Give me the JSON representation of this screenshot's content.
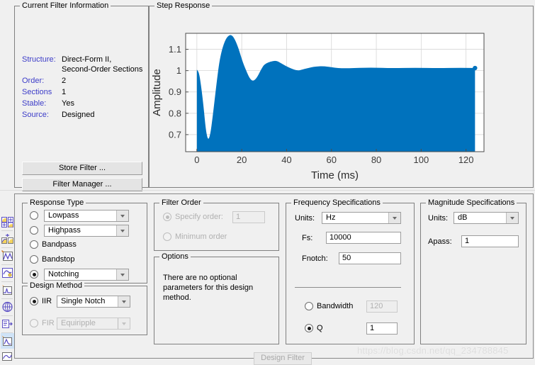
{
  "filter_info": {
    "title": "Current Filter Information",
    "rows": [
      {
        "key": "Structure:",
        "value": "Direct-Form II,",
        "value2": "Second-Order Sections"
      },
      {
        "key": "Order:",
        "value": "2"
      },
      {
        "key": "Sections",
        "value": "1"
      },
      {
        "key": "Stable:",
        "value": "Yes"
      },
      {
        "key": "Source:",
        "value": "Designed"
      }
    ],
    "store_filter_label": "Store Filter ...",
    "filter_manager_label": "Filter Manager ..."
  },
  "step_response": {
    "title": "Step Response"
  },
  "chart_data": {
    "type": "area",
    "title": "Step Response",
    "xlabel": "Time (ms)",
    "ylabel": "Amplitude",
    "xlim": [
      -5,
      128
    ],
    "ylim": [
      0.62,
      1.175
    ],
    "xticks": [
      0,
      20,
      40,
      60,
      80,
      100,
      120
    ],
    "yticks": [
      0.7,
      0.8,
      0.9,
      1,
      1.1
    ],
    "grid": true,
    "legend": "none",
    "series_color": "#0072BD",
    "note": "Dense sinusoidal ringing at notch frequency; plotted envelope of step response. Filled region spans lower clip of axis up to upper envelope.",
    "envelope_upper": [
      {
        "t": 0,
        "v": 1.005
      },
      {
        "t": 1,
        "v": 0.99
      },
      {
        "t": 2,
        "v": 0.92
      },
      {
        "t": 3,
        "v": 0.83
      },
      {
        "t": 4,
        "v": 0.72
      },
      {
        "t": 5,
        "v": 0.672
      },
      {
        "t": 6,
        "v": 0.7
      },
      {
        "t": 7,
        "v": 0.78
      },
      {
        "t": 8,
        "v": 0.87
      },
      {
        "t": 9,
        "v": 0.96
      },
      {
        "t": 10,
        "v": 1.04
      },
      {
        "t": 11,
        "v": 1.09
      },
      {
        "t": 12,
        "v": 1.125
      },
      {
        "t": 13,
        "v": 1.15
      },
      {
        "t": 14,
        "v": 1.163
      },
      {
        "t": 15,
        "v": 1.168
      },
      {
        "t": 16,
        "v": 1.162
      },
      {
        "t": 17,
        "v": 1.145
      },
      {
        "t": 18,
        "v": 1.12
      },
      {
        "t": 19,
        "v": 1.09
      },
      {
        "t": 20,
        "v": 1.055
      },
      {
        "t": 21,
        "v": 1.025
      },
      {
        "t": 22,
        "v": 1.0
      },
      {
        "t": 23,
        "v": 0.975
      },
      {
        "t": 24,
        "v": 0.958
      },
      {
        "t": 25,
        "v": 0.952
      },
      {
        "t": 26,
        "v": 0.958
      },
      {
        "t": 27,
        "v": 0.972
      },
      {
        "t": 28,
        "v": 0.992
      },
      {
        "t": 29,
        "v": 1.012
      },
      {
        "t": 30,
        "v": 1.028
      },
      {
        "t": 32,
        "v": 1.04
      },
      {
        "t": 34,
        "v": 1.045
      },
      {
        "t": 35,
        "v": 1.046
      },
      {
        "t": 36,
        "v": 1.044
      },
      {
        "t": 38,
        "v": 1.032
      },
      {
        "t": 40,
        "v": 1.02
      },
      {
        "t": 42,
        "v": 1.01
      },
      {
        "t": 44,
        "v": 1.003
      },
      {
        "t": 45,
        "v": 1.001
      },
      {
        "t": 46,
        "v": 1.002
      },
      {
        "t": 48,
        "v": 1.008
      },
      {
        "t": 50,
        "v": 1.013
      },
      {
        "t": 52,
        "v": 1.018
      },
      {
        "t": 54,
        "v": 1.02
      },
      {
        "t": 56,
        "v": 1.021
      },
      {
        "t": 58,
        "v": 1.019
      },
      {
        "t": 60,
        "v": 1.016
      },
      {
        "t": 63,
        "v": 1.012
      },
      {
        "t": 66,
        "v": 1.011
      },
      {
        "t": 70,
        "v": 1.012
      },
      {
        "t": 75,
        "v": 1.014
      },
      {
        "t": 80,
        "v": 1.014
      },
      {
        "t": 85,
        "v": 1.012
      },
      {
        "t": 90,
        "v": 1.012
      },
      {
        "t": 95,
        "v": 1.013
      },
      {
        "t": 100,
        "v": 1.013
      },
      {
        "t": 105,
        "v": 1.012
      },
      {
        "t": 110,
        "v": 1.012
      },
      {
        "t": 115,
        "v": 1.013
      },
      {
        "t": 120,
        "v": 1.013
      },
      {
        "t": 124,
        "v": 1.012
      }
    ],
    "endpoint_marker": {
      "t": 124,
      "v": 1.012
    }
  },
  "response_type": {
    "title": "Response Type",
    "options": [
      {
        "label": "Lowpass",
        "type": "combo",
        "selected": false
      },
      {
        "label": "Highpass",
        "type": "combo",
        "selected": false
      },
      {
        "label": "Bandpass",
        "type": "radio",
        "selected": false
      },
      {
        "label": "Bandstop",
        "type": "radio",
        "selected": false
      },
      {
        "label": "Notching",
        "type": "combo",
        "selected": true
      }
    ]
  },
  "design_method": {
    "title": "Design Method",
    "iir_label": "IIR",
    "iir_selected": true,
    "iir_value": "Single Notch",
    "fir_label": "FIR",
    "fir_selected": false,
    "fir_value": "Equiripple",
    "fir_disabled": true
  },
  "filter_order": {
    "title": "Filter Order",
    "specify_label": "Specify order:",
    "specify_selected": true,
    "specify_value": "1",
    "minimum_label": "Minimum order",
    "minimum_selected": false,
    "disabled": true
  },
  "options": {
    "title": "Options",
    "text": "There are no optional parameters for this design method."
  },
  "frequency_specs": {
    "title": "Frequency Specifications",
    "units_label": "Units:",
    "units_value": "Hz",
    "fs_label": "Fs:",
    "fs_value": "10000",
    "fnotch_label": "Fnotch:",
    "fnotch_value": "50",
    "bandwidth_label": "Bandwidth",
    "bandwidth_value": "120",
    "bandwidth_selected": false,
    "q_label": "Q",
    "q_value": "1",
    "q_selected": true
  },
  "magnitude_specs": {
    "title": "Magnitude Specifications",
    "units_label": "Units:",
    "units_value": "dB",
    "apass_label": "Apass:",
    "apass_value": "1"
  },
  "design_filter": {
    "label": "Design Filter",
    "enabled": false
  },
  "watermark": {
    "text": "https://blog.csdn.net/qq_234788845"
  },
  "icon_rail": {
    "items": [
      {
        "name": "magnitude-response-icon",
        "selected": false
      },
      {
        "name": "phase-response-icon",
        "selected": false
      },
      {
        "name": "magnitude-and-phase-icon",
        "selected": false
      },
      {
        "name": "group-delay-icon",
        "selected": false
      },
      {
        "name": "impulse-response-icon",
        "selected": false
      },
      {
        "name": "step-response-icon",
        "selected": false
      },
      {
        "name": "pole-zero-plot-icon",
        "selected": false
      },
      {
        "name": "filter-coefficients-icon",
        "selected": false
      },
      {
        "name": "filter-information-icon",
        "selected": true
      }
    ]
  }
}
